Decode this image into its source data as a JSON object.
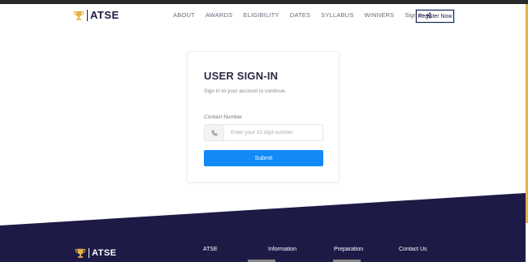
{
  "brand": {
    "name": "ATSE"
  },
  "nav": {
    "items": [
      "ABOUT",
      "AWARDS",
      "ELIGIBILITY",
      "DATES",
      "SYLLABUS",
      "WINNERS"
    ],
    "signin_label": "Sign in",
    "register_label": "Register Now"
  },
  "card": {
    "title": "USER SIGN-IN",
    "subtitle": "Sign in to your account to continue.",
    "field_label": "Contact Number",
    "placeholder": "Enter your 10 digit number",
    "submit_label": "Submit"
  },
  "footer": {
    "brand": "ATSE",
    "columns": [
      "ATSE",
      "Information",
      "Preparation",
      "Contact Us"
    ]
  },
  "colors": {
    "navy": "#1d1a46",
    "primary": "#118af6",
    "accent": "#e8b04a"
  },
  "icons": {
    "brand": "trophy-icon",
    "signin": "sign-in-arrow-icon",
    "phone": "phone-icon"
  }
}
